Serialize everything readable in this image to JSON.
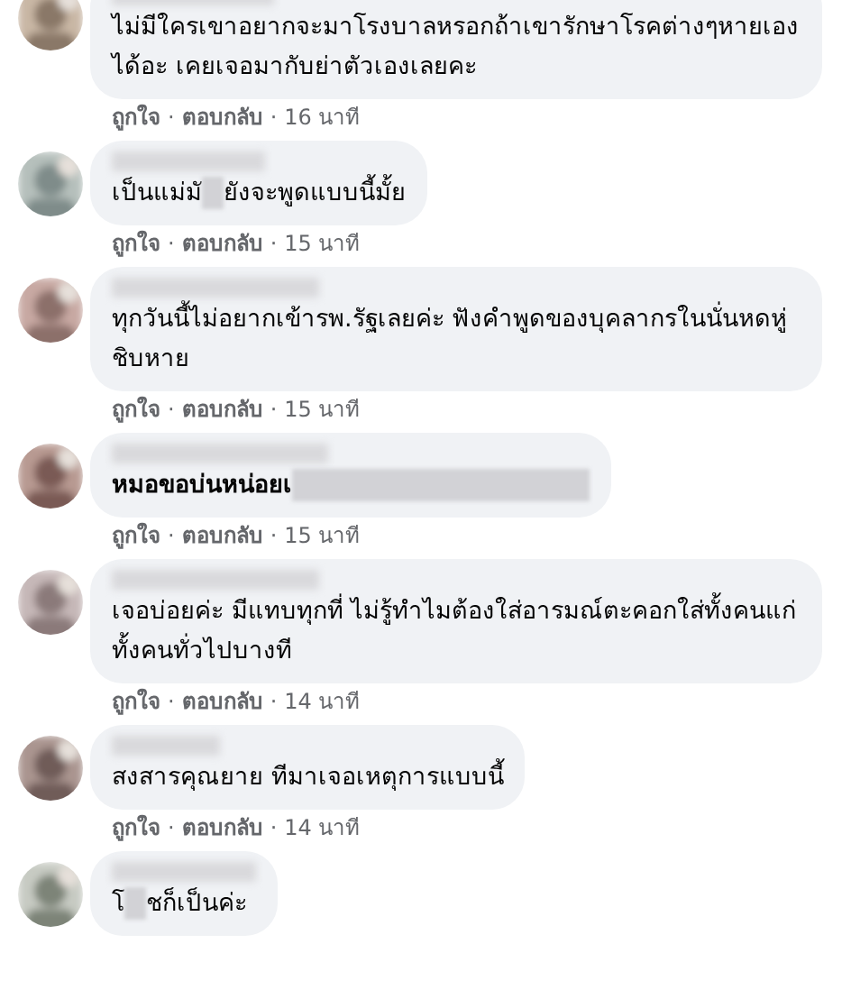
{
  "comments": [
    {
      "bold": false,
      "parts": [
        {
          "kind": "text",
          "value": "ไม่มีใครเขาอยากจะมาโรงบาลหรอกถ้าเขารักษาโรคต่างๆหายเองได้อะ เคยเจอมากับย่าตัวเองเลยคะ"
        }
      ],
      "actions": {
        "like": "ถูกใจ",
        "sep1": "·",
        "reply": "ตอบกลับ",
        "sep2": "·",
        "time": "16 นาที"
      }
    },
    {
      "bold": false,
      "parts": [
        {
          "kind": "text",
          "value": "เป็นแม่มั"
        },
        {
          "kind": "redacted"
        },
        {
          "kind": "text",
          "value": "ยังจะพูดแบบนี้มั้ย"
        }
      ],
      "actions": {
        "like": "ถูกใจ",
        "sep1": "·",
        "reply": "ตอบกลับ",
        "sep2": "·",
        "time": "15 นาที"
      }
    },
    {
      "bold": false,
      "parts": [
        {
          "kind": "text",
          "value": "ทุกวันนี้ไม่อยากเข้ารพ.รัฐเลยค่ะ ฟังคำพูดของบุคลากรในนั่นหดหู่ชิบหาย"
        }
      ],
      "actions": {
        "like": "ถูกใจ",
        "sep1": "·",
        "reply": "ตอบกลับ",
        "sep2": "·",
        "time": "15 นาที"
      }
    },
    {
      "bold": true,
      "parts": [
        {
          "kind": "text",
          "value": "หมอขอบ่นหน่อยเ"
        },
        {
          "kind": "redacted_long"
        }
      ],
      "actions": {
        "like": "ถูกใจ",
        "sep1": "·",
        "reply": "ตอบกลับ",
        "sep2": "·",
        "time": "15 นาที"
      }
    },
    {
      "bold": false,
      "parts": [
        {
          "kind": "text",
          "value": "เจอบ่อยค่ะ มีแทบทุกที่ ไม่รู้ทำไมต้องใส่อารมณ์ตะคอกใส่ทั้งคนแก่ทั้งคนทั่วไปบางที"
        }
      ],
      "actions": {
        "like": "ถูกใจ",
        "sep1": "·",
        "reply": "ตอบกลับ",
        "sep2": "·",
        "time": "14 นาที"
      }
    },
    {
      "bold": false,
      "parts": [
        {
          "kind": "text",
          "value": "สงสารคุณยาย ทีมาเจอเหตุการแบบนี้"
        }
      ],
      "actions": {
        "like": "ถูกใจ",
        "sep1": "·",
        "reply": "ตอบกลับ",
        "sep2": "·",
        "time": "14 นาที"
      }
    },
    {
      "bold": false,
      "parts": [
        {
          "kind": "text",
          "value": "โ"
        },
        {
          "kind": "redacted"
        },
        {
          "kind": "text",
          "value": "ชก็เป็นค่ะ"
        }
      ]
    }
  ]
}
